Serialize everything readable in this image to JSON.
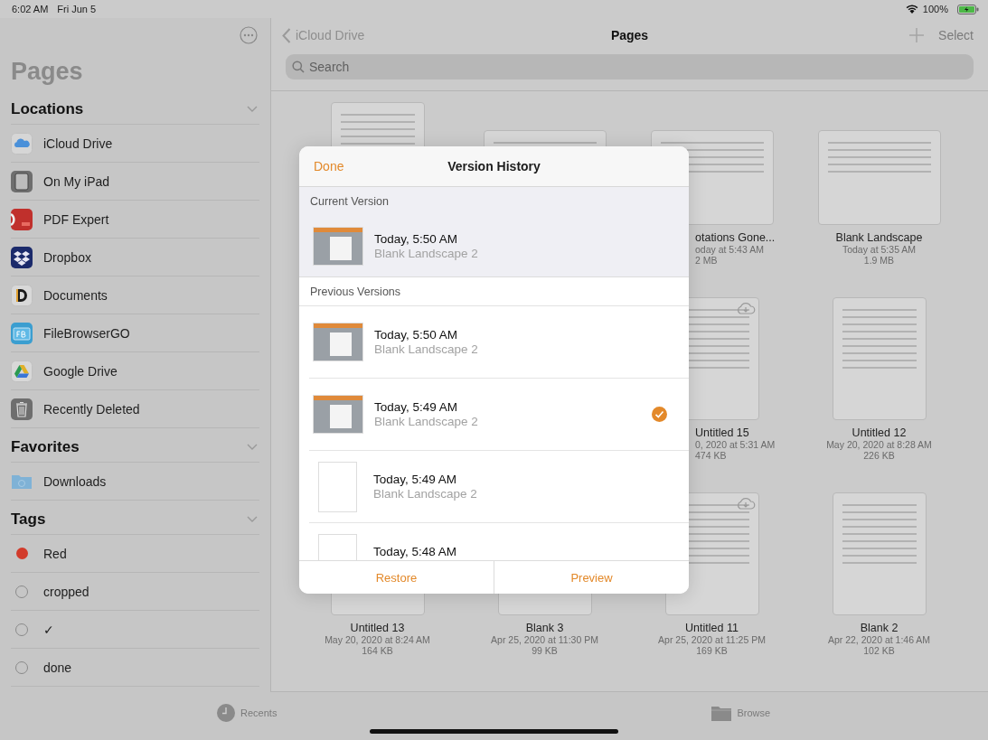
{
  "status_bar": {
    "time": "6:02 AM",
    "date": "Fri Jun 5",
    "battery": "100%"
  },
  "sidebar": {
    "title": "Pages",
    "sections": [
      {
        "title": "Locations",
        "kind": "locations",
        "items": [
          {
            "label": "iCloud Drive"
          },
          {
            "label": "On My iPad"
          },
          {
            "label": "PDF Expert"
          },
          {
            "label": "Dropbox"
          },
          {
            "label": "Documents"
          },
          {
            "label": "FileBrowserGO"
          },
          {
            "label": "Google Drive"
          },
          {
            "label": "Recently Deleted"
          }
        ]
      },
      {
        "title": "Favorites",
        "kind": "favorites",
        "items": [
          {
            "label": "Downloads"
          }
        ]
      },
      {
        "title": "Tags",
        "kind": "tags",
        "items": [
          {
            "label": "Red",
            "color": "#d23b2b"
          },
          {
            "label": "cropped"
          },
          {
            "label": "✓"
          },
          {
            "label": "done"
          }
        ]
      }
    ]
  },
  "navigation": {
    "back": "iCloud Drive",
    "title": "Pages",
    "select": "Select"
  },
  "search": {
    "placeholder": "Search"
  },
  "files": [
    {
      "kind": "covered"
    },
    {
      "kind": "covered"
    },
    {
      "kind": "clipped",
      "name": "otations Gone...",
      "date": "oday at 5:43 AM",
      "size": "2 MB"
    },
    {
      "kind": "full",
      "name": "Blank Landscape",
      "date": "Today at 5:35 AM",
      "size": "1.9 MB"
    },
    {
      "kind": "covered"
    },
    {
      "kind": "covered"
    },
    {
      "kind": "clipped",
      "cloud": true,
      "name": "Untitled 15",
      "date": "0, 2020 at 5:31 AM",
      "size": "474 KB"
    },
    {
      "kind": "full",
      "name": "Untitled 12",
      "date": "May 20, 2020 at 8:28 AM",
      "size": "226 KB"
    },
    {
      "kind": "full",
      "name": "Untitled 13",
      "date": "May 20, 2020 at 8:24 AM",
      "size": "164 KB"
    },
    {
      "kind": "full",
      "name": "Blank 3",
      "date": "Apr 25, 2020 at 11:30 PM",
      "size": "99 KB"
    },
    {
      "kind": "full",
      "cloud": true,
      "name": "Untitled 11",
      "date": "Apr 25, 2020 at 11:25 PM",
      "size": "169 KB"
    },
    {
      "kind": "full",
      "name": "Blank 2",
      "date": "Apr 22, 2020 at 1:46 AM",
      "size": "102 KB"
    }
  ],
  "version_history": {
    "done": "Done",
    "title": "Version History",
    "current_header": "Current Version",
    "current": {
      "time": "Today, 5:50 AM",
      "name": "Blank Landscape 2"
    },
    "previous_header": "Previous Versions",
    "previous": [
      {
        "time": "Today, 5:50 AM",
        "name": "Blank Landscape 2",
        "selected": false
      },
      {
        "time": "Today, 5:49 AM",
        "name": "Blank Landscape 2",
        "selected": true
      },
      {
        "time": "Today, 5:49 AM",
        "name": "Blank Landscape 2",
        "selected": false
      },
      {
        "time": "Today, 5:48 AM",
        "selected": false
      }
    ],
    "buttons": [
      "Restore",
      "Preview"
    ]
  },
  "tab_bar": [
    {
      "label": "Recents",
      "selected": false
    },
    {
      "label": "Browse",
      "selected": false
    }
  ]
}
